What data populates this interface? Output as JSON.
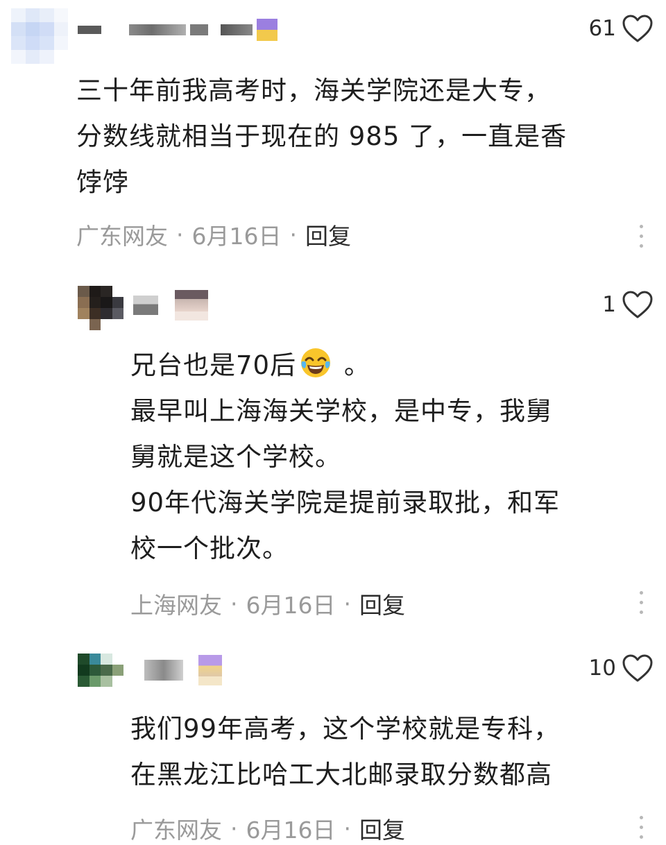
{
  "comments": [
    {
      "likes": "61",
      "text": "三十年前我高考时，海关学院还是大专，\n分数线就相当于现在的 985 了，一直是香\n饽饽",
      "location": "广东网友",
      "date": "6月16日",
      "reply": "回复"
    },
    {
      "likes": "1",
      "text_before_emoji": "兄台也是70后",
      "text_after_emoji": " 。",
      "text_rest": "最早叫上海海关学校，是中专，我舅\n舅就是这个学校。\n90年代海关学院是提前录取批，和军\n校一个批次。",
      "location": "上海网友",
      "date": "6月16日",
      "reply": "回复"
    },
    {
      "likes": "10",
      "text": "我们99年高考，这个学校就是专科，\n在黑龙江比哈工大北邮录取分数都高",
      "location": "广东网友",
      "date": "6月16日",
      "reply": "回复"
    }
  ],
  "separator": "·",
  "icons": {
    "like": "heart-outline-icon",
    "more": "more-vertical-icon",
    "emoji": "tears-of-joy-emoji-icon"
  },
  "colors": {
    "text": "#1e1e1e",
    "meta": "#9a9a9a",
    "more_dots": "#b8b8b8"
  }
}
